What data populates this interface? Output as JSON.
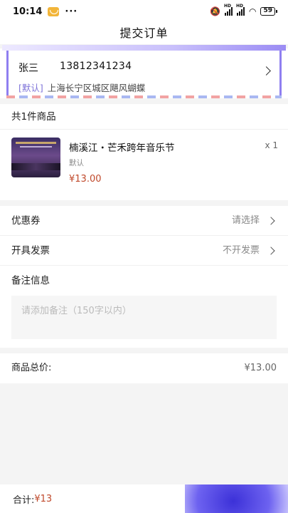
{
  "status_bar": {
    "time": "10:14",
    "dots": "···",
    "battery": "59"
  },
  "navbar": {
    "title": "提交订单"
  },
  "address": {
    "name": "张三",
    "phone": "13812341234",
    "default_tag": "[默认]",
    "detail": "上海长宁区城区飓风蝴蝶"
  },
  "goods": {
    "header": "共1件商品",
    "items": [
      {
        "title": "楠溪江・芒禾跨年音乐节",
        "spec": "默认",
        "price": "¥13.00",
        "qty": "x 1"
      }
    ]
  },
  "coupon": {
    "label": "优惠券",
    "value": "请选择"
  },
  "invoice": {
    "label": "开具发票",
    "value": "不开发票"
  },
  "remark": {
    "label": "备注信息",
    "placeholder": "请添加备注（150字以内）"
  },
  "summary": {
    "label": "商品总价:",
    "value": "¥13.00"
  },
  "footer": {
    "total_label": "合计:",
    "total_amount": "¥13"
  },
  "colors": {
    "accent": "#6d62f0",
    "price": "#c0492b"
  }
}
